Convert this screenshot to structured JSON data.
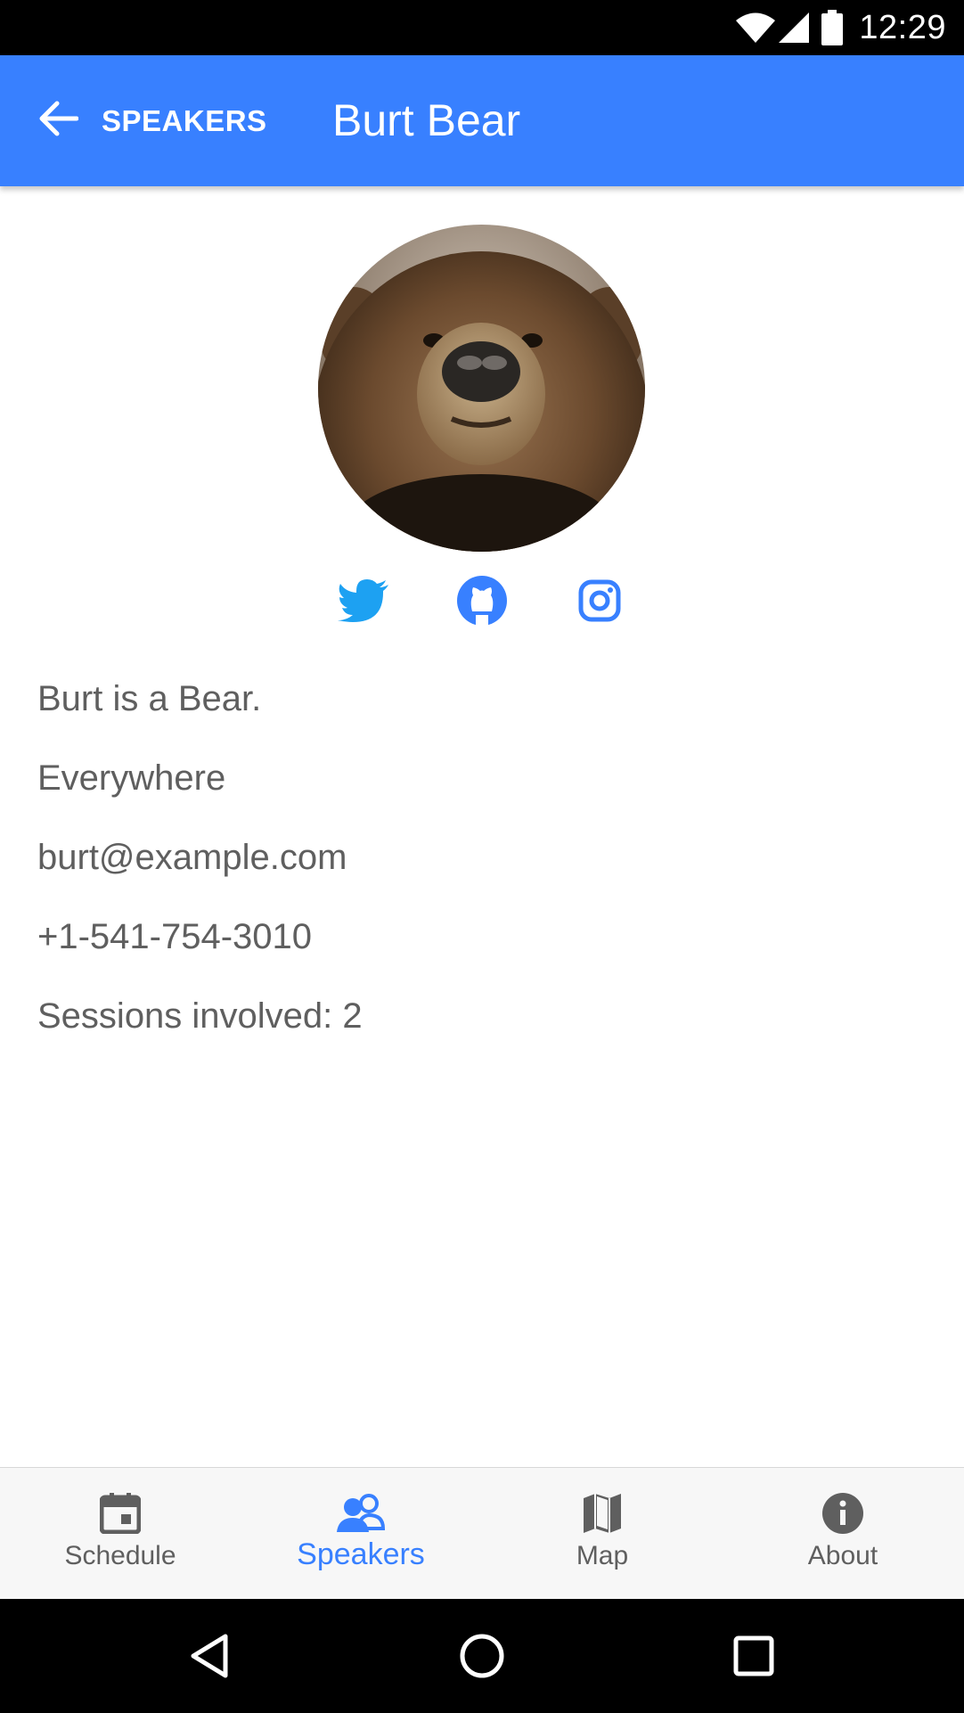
{
  "status_bar": {
    "time": "12:29",
    "icons": [
      "wifi-icon",
      "signal-icon",
      "battery-icon"
    ]
  },
  "header": {
    "back_label": "SPEAKERS",
    "title": "Burt Bear"
  },
  "speaker": {
    "avatar": "bear-photo",
    "bio": "Burt is a Bear.",
    "location": "Everywhere",
    "email": "burt@example.com",
    "phone": "+1-541-754-3010",
    "sessions": "Sessions involved: 2"
  },
  "social": [
    {
      "name": "twitter-icon",
      "color": "#1da1f2"
    },
    {
      "name": "github-icon",
      "color": "#3880ff"
    },
    {
      "name": "instagram-icon",
      "color": "#3880ff"
    }
  ],
  "tabs": [
    {
      "label": "Schedule",
      "icon": "calendar-icon"
    },
    {
      "label": "Speakers",
      "icon": "people-icon",
      "active": true
    },
    {
      "label": "Map",
      "icon": "map-icon"
    },
    {
      "label": "About",
      "icon": "info-icon"
    }
  ],
  "colors": {
    "primary": "#3880ff",
    "text": "#5f5f5f",
    "tab_inactive": "#5f5f5f"
  }
}
